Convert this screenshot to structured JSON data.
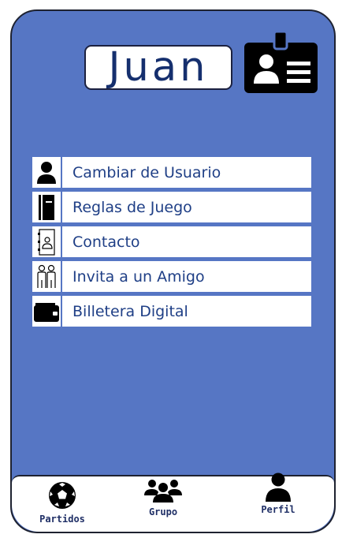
{
  "profile": {
    "name": "Juan"
  },
  "icons": {
    "header_card": "id-card-icon"
  },
  "menu": {
    "items": [
      {
        "label": "Cambiar de Usuario",
        "icon": "user-icon"
      },
      {
        "label": "Reglas de Juego",
        "icon": "rulebook-icon"
      },
      {
        "label": "Contacto",
        "icon": "contact-card-icon"
      },
      {
        "label": "Invita a un Amigo",
        "icon": "friends-icon"
      },
      {
        "label": "Billetera Digital",
        "icon": "wallet-icon"
      }
    ]
  },
  "tabbar": {
    "tabs": [
      {
        "label": "Partidos",
        "icon": "soccer-ball-icon"
      },
      {
        "label": "Grupo",
        "icon": "group-icon"
      },
      {
        "label": "Perfil",
        "icon": "profile-icon"
      }
    ]
  },
  "colors": {
    "background": "#5676c4",
    "text": "#1f3f86",
    "dark": "#000000"
  }
}
